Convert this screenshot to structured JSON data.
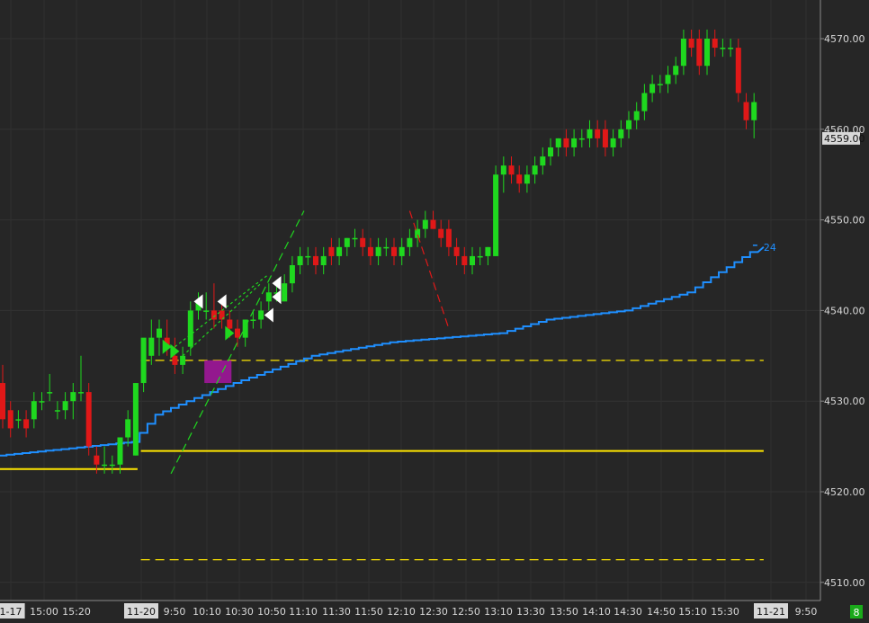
{
  "chart_data": {
    "type": "candlestick",
    "title": "",
    "xlabel": "",
    "ylabel": "",
    "ylim": [
      4506,
      4575
    ],
    "y_ticks": [
      4510,
      4520,
      4530,
      4540,
      4550,
      4560,
      4570
    ],
    "last_price_label": "4559.00",
    "x_ticks": [
      "1-17",
      "15:00",
      "15:20",
      "11-20",
      "9:50",
      "10:10",
      "10:30",
      "10:50",
      "11:10",
      "11:30",
      "11:50",
      "12:10",
      "12:30",
      "12:50",
      "13:10",
      "13:30",
      "13:50",
      "14:10",
      "14:30",
      "14:50",
      "15:10",
      "15:30",
      "11-21",
      "9:50"
    ],
    "x_tick_highlighted": [
      "1-17",
      "11-20",
      "11-21"
    ],
    "badge": "8",
    "colors": {
      "up": "#1fd81f",
      "down": "#e01818",
      "vwap": "#1f8fff",
      "level": "#ffe600",
      "box": "#a0179a",
      "trend_green": "#1fd81f",
      "trend_red": "#e01818"
    },
    "candles": [
      [
        4532,
        4534,
        4527,
        4528
      ],
      [
        4529,
        4530,
        4526,
        4527
      ],
      [
        4528,
        4529,
        4527,
        4528
      ],
      [
        4528,
        4529,
        4526,
        4527
      ],
      [
        4528,
        4531,
        4527,
        4530
      ],
      [
        4530,
        4531,
        4529,
        4530
      ],
      [
        4531,
        4533,
        4530,
        4531
      ],
      [
        4529,
        4530,
        4528,
        4529
      ],
      [
        4529,
        4531,
        4528,
        4530
      ],
      [
        4530,
        4532,
        4528,
        4531
      ],
      [
        4531,
        4535,
        4530,
        4531
      ],
      [
        4531,
        4532,
        4524,
        4525
      ],
      [
        4524,
        4525,
        4522,
        4523
      ],
      [
        4523,
        4525,
        4522,
        4523
      ],
      [
        4523,
        4524,
        4522,
        4523
      ],
      [
        4523,
        4526,
        4522,
        4526
      ],
      [
        4526,
        4529,
        4525,
        4528
      ],
      [
        4524,
        4532,
        4524,
        4532
      ],
      [
        4532,
        4536,
        4531,
        4537
      ],
      [
        4535,
        4539,
        4534,
        4537
      ],
      [
        4537,
        4539,
        4535,
        4538
      ],
      [
        4537,
        4539,
        4535,
        4536
      ],
      [
        4535,
        4537,
        4533,
        4534
      ],
      [
        4534,
        4536,
        4533,
        4535
      ],
      [
        4536,
        4541,
        4535,
        4540
      ],
      [
        4540,
        4542,
        4539,
        4541
      ],
      [
        4540,
        4542,
        4539,
        4540
      ],
      [
        4540,
        4543,
        4538,
        4539
      ],
      [
        4540,
        4541,
        4538,
        4539
      ],
      [
        4539,
        4540,
        4537,
        4538
      ],
      [
        4538,
        4539,
        4536,
        4537
      ],
      [
        4537,
        4539,
        4536,
        4539
      ],
      [
        4539,
        4540,
        4538,
        4539
      ],
      [
        4539,
        4541,
        4538,
        4540
      ],
      [
        4541,
        4543,
        4540,
        4542
      ],
      [
        4542,
        4543,
        4541,
        4542
      ],
      [
        4541,
        4544,
        4541,
        4543
      ],
      [
        4543,
        4546,
        4542,
        4545
      ],
      [
        4545,
        4547,
        4544,
        4546
      ],
      [
        4546,
        4547,
        4545,
        4546
      ],
      [
        4546,
        4547,
        4544,
        4545
      ],
      [
        4545,
        4547,
        4544,
        4546
      ],
      [
        4547,
        4548,
        4545,
        4546
      ],
      [
        4546,
        4548,
        4545,
        4547
      ],
      [
        4547,
        4548,
        4546,
        4548
      ],
      [
        4548,
        4549,
        4547,
        4548
      ],
      [
        4548,
        4549,
        4546,
        4547
      ],
      [
        4547,
        4548,
        4545,
        4546
      ],
      [
        4546,
        4548,
        4545,
        4547
      ],
      [
        4547,
        4548,
        4546,
        4547
      ],
      [
        4547,
        4548,
        4545,
        4546
      ],
      [
        4546,
        4548,
        4545,
        4547
      ],
      [
        4547,
        4549,
        4546,
        4548
      ],
      [
        4548,
        4550,
        4547,
        4549
      ],
      [
        4549,
        4551,
        4548,
        4550
      ],
      [
        4550,
        4551,
        4549,
        4549
      ],
      [
        4549,
        4550,
        4547,
        4548
      ],
      [
        4549,
        4550,
        4546,
        4547
      ],
      [
        4547,
        4548,
        4545,
        4546
      ],
      [
        4546,
        4547,
        4544,
        4545
      ],
      [
        4545,
        4547,
        4544,
        4546
      ],
      [
        4546,
        4547,
        4545,
        4546
      ],
      [
        4546,
        4547,
        4545,
        4547
      ],
      [
        4546,
        4556,
        4546,
        4555
      ],
      [
        4555,
        4557,
        4553,
        4556
      ],
      [
        4556,
        4557,
        4554,
        4555
      ],
      [
        4555,
        4556,
        4553,
        4554
      ],
      [
        4554,
        4556,
        4553,
        4555
      ],
      [
        4555,
        4557,
        4554,
        4556
      ],
      [
        4556,
        4558,
        4555,
        4557
      ],
      [
        4557,
        4559,
        4556,
        4558
      ],
      [
        4558,
        4559,
        4557,
        4559
      ],
      [
        4559,
        4560,
        4557,
        4558
      ],
      [
        4558,
        4560,
        4557,
        4559
      ],
      [
        4559,
        4560,
        4558,
        4559
      ],
      [
        4559,
        4561,
        4558,
        4560
      ],
      [
        4560,
        4561,
        4558,
        4559
      ],
      [
        4560,
        4561,
        4557,
        4558
      ],
      [
        4558,
        4560,
        4557,
        4559
      ],
      [
        4559,
        4561,
        4558,
        4560
      ],
      [
        4560,
        4562,
        4559,
        4561
      ],
      [
        4561,
        4563,
        4560,
        4562
      ],
      [
        4562,
        4565,
        4561,
        4564
      ],
      [
        4564,
        4566,
        4563,
        4565
      ],
      [
        4565,
        4566,
        4564,
        4565
      ],
      [
        4565,
        4567,
        4564,
        4566
      ],
      [
        4566,
        4568,
        4565,
        4567
      ],
      [
        4567,
        4571,
        4566,
        4570
      ],
      [
        4570,
        4571,
        4568,
        4569
      ],
      [
        4570,
        4571,
        4566,
        4567
      ],
      [
        4567,
        4571,
        4566,
        4570
      ],
      [
        4570,
        4571,
        4568,
        4569
      ],
      [
        4569,
        4570,
        4568,
        4569
      ],
      [
        4569,
        4570,
        4568,
        4569
      ],
      [
        4569,
        4570,
        4563,
        4564
      ],
      [
        4563,
        4564,
        4560,
        4561
      ],
      [
        4561,
        4564,
        4559,
        4563
      ]
    ],
    "vwap_end_label": "24",
    "vwap": [
      [
        0,
        4524
      ],
      [
        17,
        4525.5
      ],
      [
        18,
        4526.5
      ],
      [
        20,
        4528.5
      ],
      [
        24,
        4530
      ],
      [
        30,
        4532
      ],
      [
        40,
        4535
      ],
      [
        50,
        4536.5
      ],
      [
        64,
        4537.5
      ],
      [
        70,
        4539
      ],
      [
        80,
        4540
      ],
      [
        88,
        4542
      ],
      [
        97,
        4547
      ]
    ],
    "levels": [
      {
        "price": 4534.5,
        "style": "dashed",
        "from": 18,
        "to": 97
      },
      {
        "price": 4524.5,
        "style": "solid",
        "from": 18,
        "to": 97
      },
      {
        "price": 4522.5,
        "style": "solid",
        "from": 0,
        "to": 17
      },
      {
        "price": 4512.5,
        "style": "dashed",
        "from": 18,
        "to": 97
      }
    ],
    "box": {
      "x0": 26,
      "x1": 29,
      "y0": 4532,
      "y1": 4534.5
    },
    "trend_lines": [
      {
        "color": "green",
        "dash": "long",
        "p0": [
          21.5,
          4522
        ],
        "p1": [
          38.5,
          4551
        ]
      },
      {
        "color": "green",
        "dash": "short",
        "p0": [
          22,
          4536
        ],
        "p1": [
          34,
          4544
        ]
      },
      {
        "color": "green",
        "dash": "short",
        "p0": [
          23,
          4535
        ],
        "p1": [
          33,
          4543
        ]
      },
      {
        "color": "red",
        "dash": "long",
        "p0": [
          52,
          4551
        ],
        "p1": [
          57,
          4538
        ]
      }
    ],
    "markers": [
      {
        "i": 21,
        "type": "green-right",
        "price": 4536
      },
      {
        "i": 22,
        "type": "green-right",
        "price": 4535.5
      },
      {
        "i": 25,
        "type": "white-left",
        "price": 4541
      },
      {
        "i": 28,
        "type": "white-left",
        "price": 4541
      },
      {
        "i": 29,
        "type": "green-right",
        "price": 4537.5
      },
      {
        "i": 34,
        "type": "white-left",
        "price": 4539.5
      },
      {
        "i": 35,
        "type": "white-left",
        "price": 4541.5
      },
      {
        "i": 35,
        "type": "white-left",
        "price": 4543
      }
    ]
  }
}
